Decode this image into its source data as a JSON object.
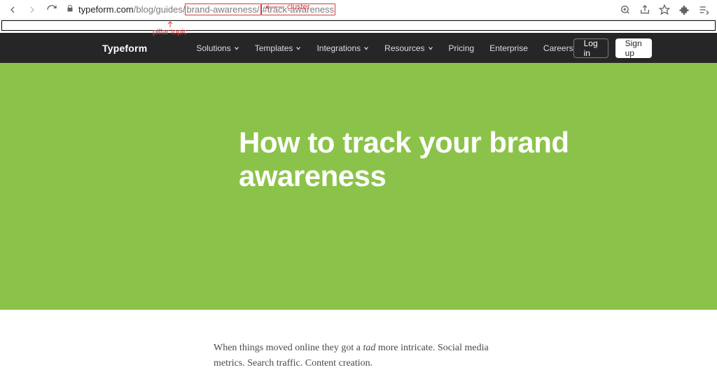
{
  "url": {
    "domain": "typeform.com",
    "path_prefix": "/blog/guides/",
    "pillar_segment": "brand-awareness/",
    "cluster_segment": "#track-awareness"
  },
  "annotations": {
    "pillar_label": "pillar topic",
    "cluster_label": "cluster"
  },
  "header": {
    "logo": "Typeform",
    "nav": {
      "solutions": "Solutions",
      "templates": "Templates",
      "integrations": "Integrations",
      "resources": "Resources",
      "pricing": "Pricing",
      "enterprise": "Enterprise",
      "careers": "Careers"
    },
    "login_label": "Log in",
    "signup_label": "Sign up"
  },
  "hero": {
    "title": "How to track your brand awareness"
  },
  "body": {
    "p1_a": "When things moved online they got a ",
    "p1_em": "tad",
    "p1_b": " more intricate. Social media metrics. Search traffic. Content creation."
  },
  "colors": {
    "accent_green": "#8bc34a",
    "header_bg": "#262627",
    "annotation_red": "#d43c3c"
  }
}
